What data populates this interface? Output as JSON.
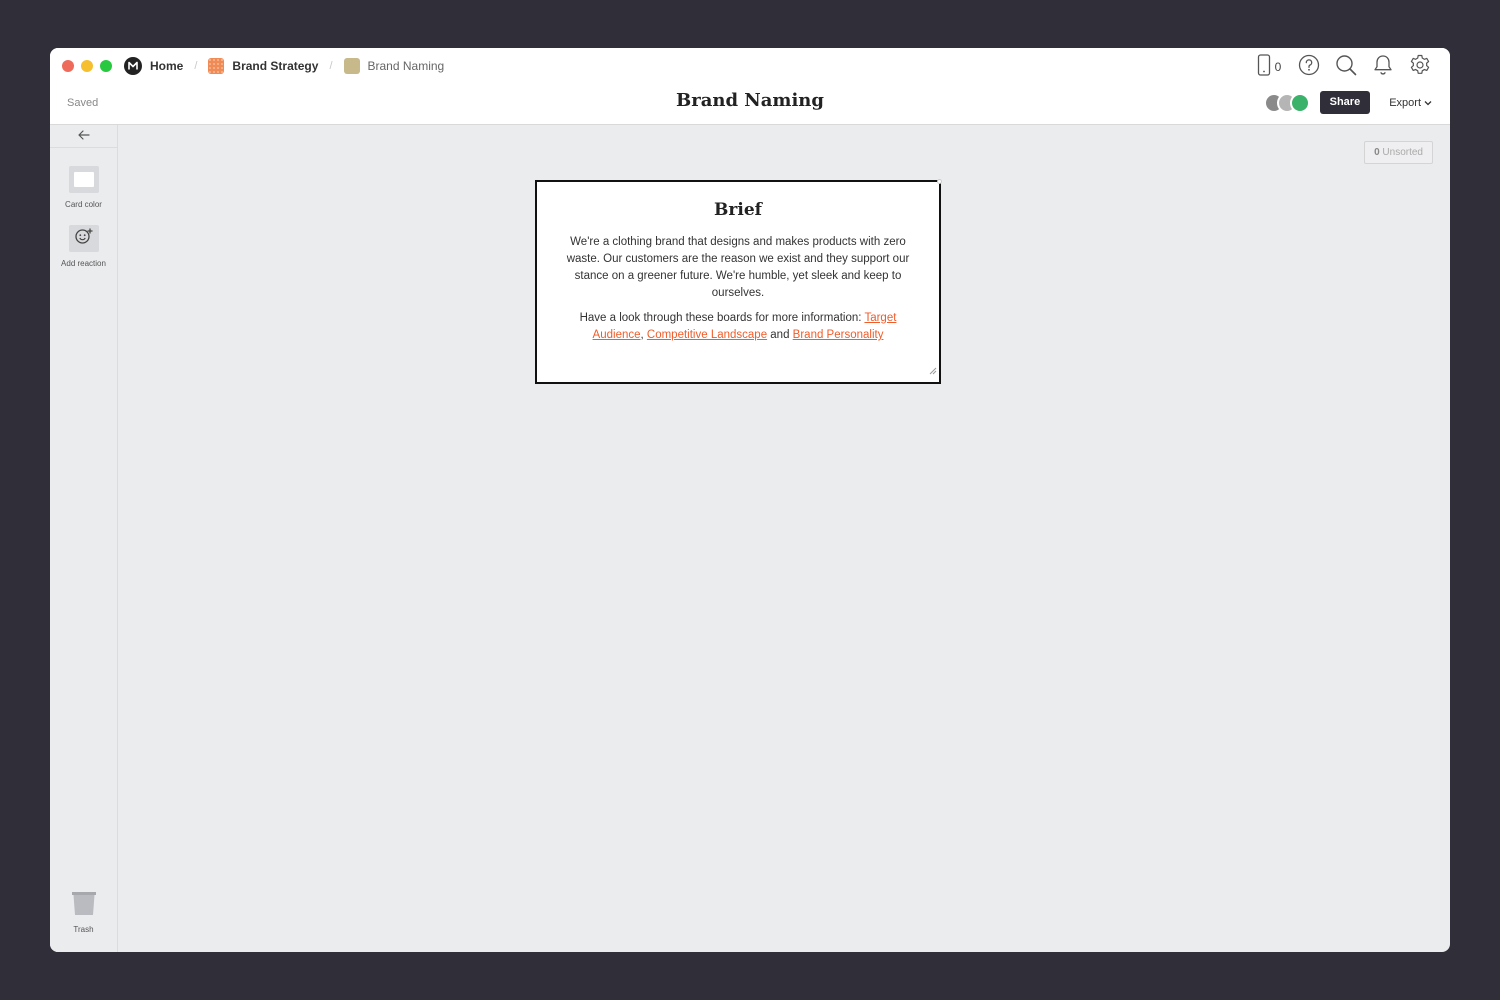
{
  "breadcrumb": {
    "home_label": "Home",
    "strategy_label": "Brand Strategy",
    "current_label": "Brand Naming",
    "separator": "/"
  },
  "header": {
    "saved_status": "Saved",
    "title": "Brand Naming",
    "phone_count": "0",
    "share_label": "Share",
    "export_label": "Export"
  },
  "sidebar": {
    "card_color_label": "Card color",
    "add_reaction_label": "Add reaction",
    "trash_label": "Trash"
  },
  "canvas": {
    "unsorted_count": "0",
    "unsorted_label": "Unsorted"
  },
  "card": {
    "title": "Brief",
    "body": "We're a clothing brand that designs and makes products with zero waste. Our customers are the reason we exist and they support our stance on a greener future. We're humble, yet sleek and keep to ourselves.",
    "links_intro": "Have a look through these boards for more information: ",
    "link_1": "Target Audience",
    "sep_1": ", ",
    "link_2": "Competitive Landscape",
    "sep_2": " and ",
    "link_3": "Brand Personality"
  },
  "colors": {
    "accent_link": "#f05c2a",
    "share_button": "#2f2e39",
    "canvas_bg": "#ebecee",
    "frame_bg": "#2f2e39"
  },
  "icons": [
    "phone-icon",
    "help-icon",
    "search-icon",
    "bell-icon",
    "gear-icon",
    "back-arrow-icon",
    "reaction-icon",
    "trash-icon",
    "chevron-down-icon"
  ]
}
